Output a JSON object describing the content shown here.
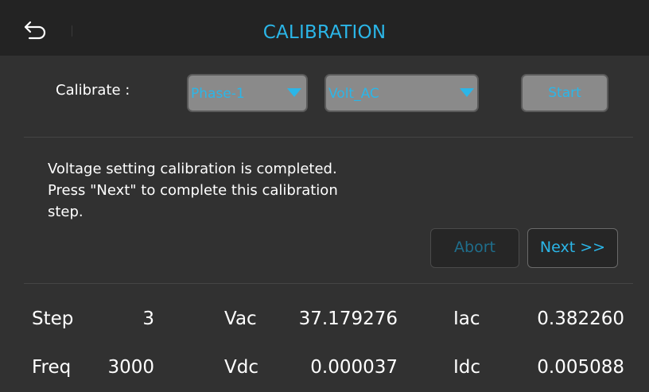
{
  "header": {
    "title": "CALIBRATION",
    "back_icon": "back-arrow-icon"
  },
  "controls": {
    "calibrate_label": "Calibrate :",
    "phase_select": "Phase-1",
    "mode_select": "Volt_AC",
    "start_label": "Start"
  },
  "message": {
    "line1": "Voltage setting calibration is completed.",
    "line2": "Press \"Next\" to complete this calibration",
    "line3": "step."
  },
  "buttons": {
    "abort_label": "Abort",
    "next_label": "Next >>"
  },
  "readings": {
    "step_label": "Step",
    "step_value": "3",
    "vac_label": "Vac",
    "vac_value": "37.179276",
    "iac_label": "Iac",
    "iac_value": "0.382260",
    "freq_label": "Freq",
    "freq_value": "3000",
    "vdc_label": "Vdc",
    "vdc_value": "0.000037",
    "idc_label": "Idc",
    "idc_value": "0.005088"
  },
  "colors": {
    "accent": "#2bb6e8",
    "background": "#313131",
    "title_bar": "#232323",
    "disabled_fill": "#8a8a8a"
  }
}
